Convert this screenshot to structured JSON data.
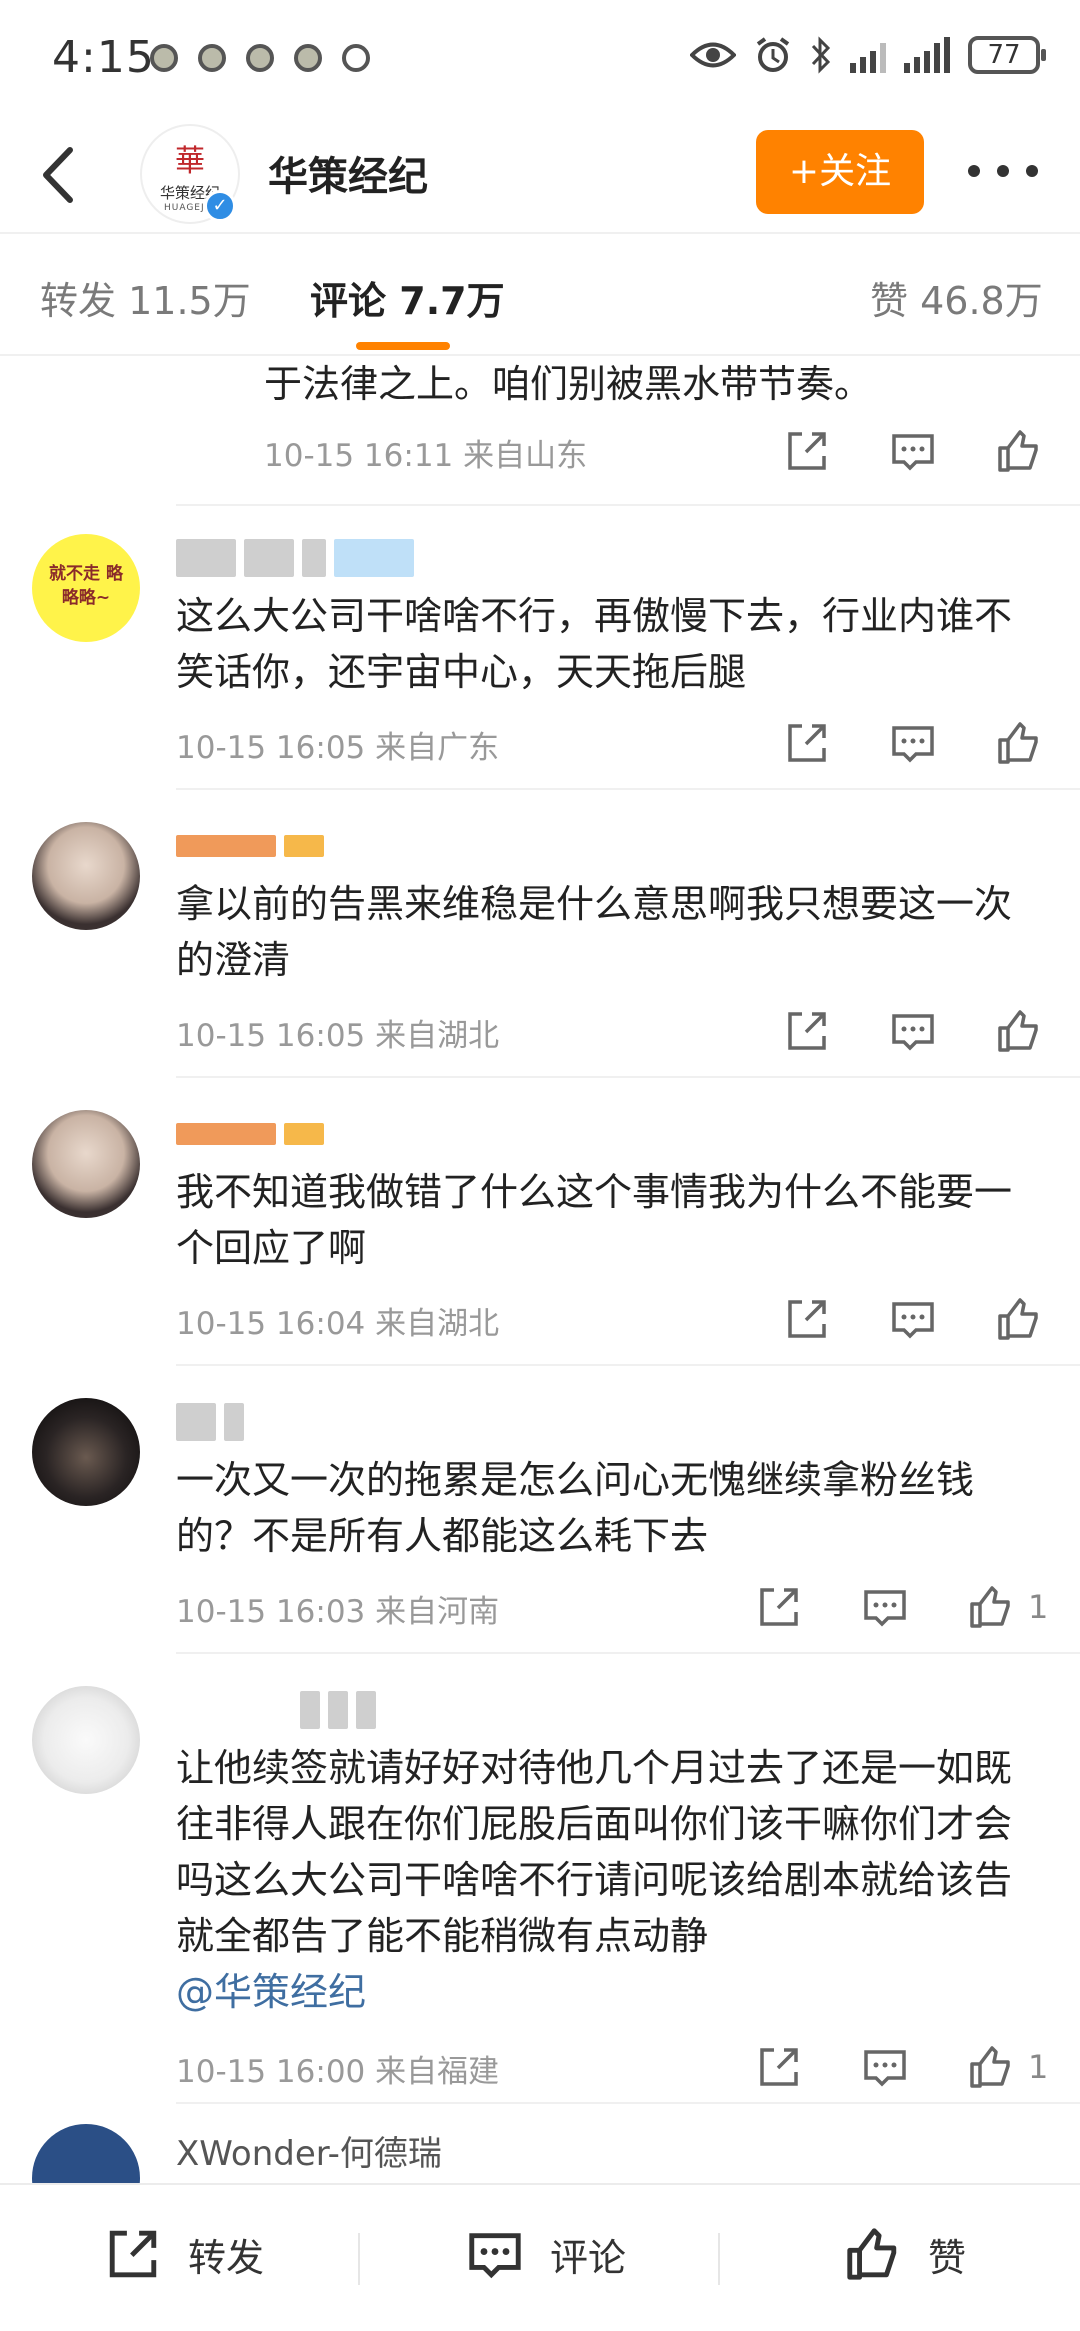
{
  "status_bar": {
    "time": "4:15",
    "battery": "77"
  },
  "header": {
    "account_name": "华策经纪",
    "follow_label": "+关注",
    "avatar_logo_cn": "华策经纪",
    "avatar_logo_en": "HUAGEJIN"
  },
  "tabs": [
    {
      "label": "转发",
      "count": "11.5万"
    },
    {
      "label": "评论",
      "count": "7.7万"
    },
    {
      "label": "赞",
      "count": "46.8万"
    }
  ],
  "comments": [
    {
      "text": "于法律之上。咱们别被黑水带节奏。",
      "time": "10-15 16:11",
      "location": "来自山东",
      "likes": ""
    },
    {
      "name": "",
      "text": "这么大公司干啥啥不行，再傲慢下去，行业内谁不笑话你，还宇宙中心，天天拖后腿",
      "time": "10-15 16:05",
      "location": "来自广东",
      "likes": "",
      "avatar_text": "就不走 略略略~"
    },
    {
      "name": "",
      "text": "拿以前的告黑来维稳是什么意思啊我只想要这一次的澄清",
      "time": "10-15 16:05",
      "location": "来自湖北",
      "likes": ""
    },
    {
      "name": "",
      "text": "我不知道我做错了什么这个事情我为什么不能要一个回应了啊",
      "time": "10-15 16:04",
      "location": "来自湖北",
      "likes": ""
    },
    {
      "name": "",
      "text": "一次又一次的拖累是怎么问心无愧继续拿粉丝钱的？不是所有人都能这么耗下去",
      "time": "10-15 16:03",
      "location": "来自河南",
      "likes": "1"
    },
    {
      "name": "",
      "text": "让他续签就请好好对待他几个月过去了还是一如既往非得人跟在你们屁股后面叫你们该干嘛你们才会吗这么大公司干啥啥不行请问呢该给剧本就给该告就全都告了能不能稍微有点动静",
      "mention": "@华策经纪",
      "time": "10-15 16:00",
      "location": "来自福建",
      "likes": "1"
    },
    {
      "name": "XWonder-何德瑞"
    }
  ],
  "bottom_bar": {
    "repost": "转发",
    "comment": "评论",
    "like": "赞"
  }
}
